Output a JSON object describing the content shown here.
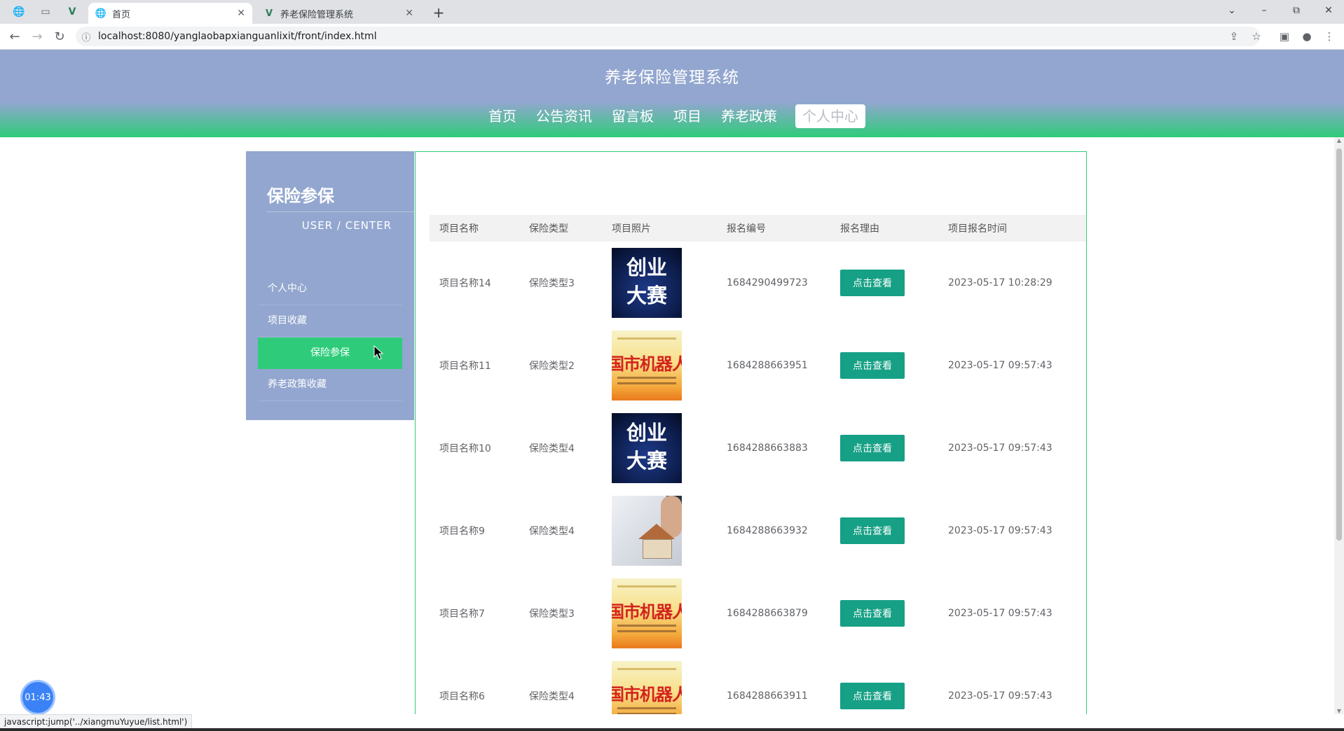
{
  "browser": {
    "tabs": [
      {
        "title": "首页",
        "icon": "globe-icon",
        "active": true
      },
      {
        "title": "养老保险管理系统",
        "icon": "vue-icon",
        "active": false
      }
    ],
    "url": "localhost:8080/yanglaobapxianguanlixit/front/index.html",
    "status_text": "javascript:jump('../xiangmuYuyue/list.html')"
  },
  "site": {
    "title": "养老保险管理系统",
    "nav": [
      "首页",
      "公告资讯",
      "留言板",
      "项目",
      "养老政策",
      "个人中心"
    ],
    "active_nav": "个人中心"
  },
  "sidebar": {
    "title": "保险参保",
    "subtitle": "USER / CENTER",
    "items": [
      "个人中心",
      "项目收藏",
      "保险参保",
      "养老政策收藏"
    ],
    "active_item": "保险参保"
  },
  "table": {
    "headers": [
      "项目名称",
      "保险类型",
      "项目照片",
      "报名编号",
      "报名理由",
      "项目报名时间"
    ],
    "button_label": "点击查看",
    "rows": [
      {
        "name": "项目名称14",
        "type": "保险类型3",
        "photo": "创业大赛",
        "code": "1684290499723",
        "time": "2023-05-17 10:28:29"
      },
      {
        "name": "项目名称11",
        "type": "保险类型2",
        "photo": "robot-poster",
        "code": "1684288663951",
        "time": "2023-05-17 09:57:43"
      },
      {
        "name": "项目名称10",
        "type": "保险类型4",
        "photo": "创业大赛",
        "code": "1684288663883",
        "time": "2023-05-17 09:57:43"
      },
      {
        "name": "项目名称9",
        "type": "保险类型4",
        "photo": "house-model",
        "code": "1684288663932",
        "time": "2023-05-17 09:57:43"
      },
      {
        "name": "项目名称7",
        "type": "保险类型3",
        "photo": "robot-poster",
        "code": "1684288663879",
        "time": "2023-05-17 09:57:43"
      },
      {
        "name": "项目名称6",
        "type": "保险类型4",
        "photo": "robot-poster",
        "code": "1684288663911",
        "time": "2023-05-17 09:57:43"
      }
    ]
  },
  "poster": {
    "cyds_line1": "创业",
    "cyds_line2": "大赛",
    "robot_text": "国市机器人竞"
  },
  "timer": "01:43",
  "colors": {
    "header_blue": "#92a6cf",
    "accent_green": "#2ecc7a",
    "button_teal": "#16a085"
  }
}
